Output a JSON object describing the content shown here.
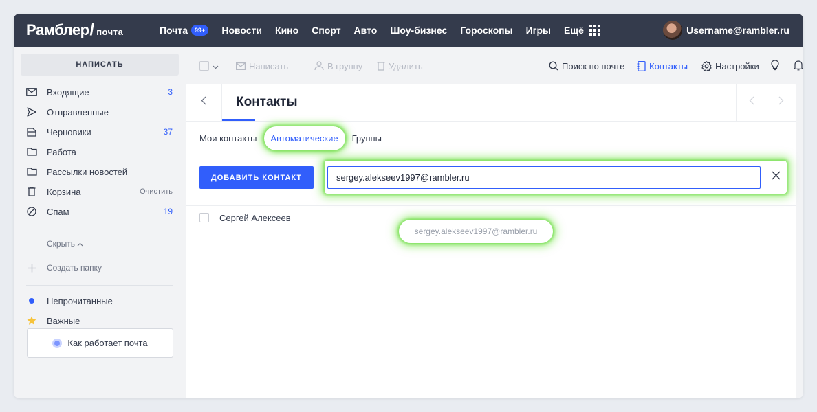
{
  "header": {
    "logo_main": "Рамблер",
    "logo_slash": "/",
    "logo_sub": "почта",
    "nav": [
      {
        "label": "Почта",
        "badge": "99+"
      },
      {
        "label": "Новости"
      },
      {
        "label": "Кино"
      },
      {
        "label": "Спорт"
      },
      {
        "label": "Авто"
      },
      {
        "label": "Шоу-бизнес"
      },
      {
        "label": "Гороскопы"
      },
      {
        "label": "Игры"
      },
      {
        "label": "Ещё"
      }
    ],
    "user": "Username@rambler.ru"
  },
  "sidebar": {
    "compose_label": "НАПИСАТЬ",
    "folders": [
      {
        "label": "Входящие",
        "count": "3",
        "icon": "inbox-icon"
      },
      {
        "label": "Отправленные",
        "count": "",
        "icon": "sent-icon"
      },
      {
        "label": "Черновики",
        "count": "37",
        "icon": "drafts-icon"
      },
      {
        "label": "Работа",
        "count": "",
        "icon": "folder-icon"
      },
      {
        "label": "Рассылки новостей",
        "count": "",
        "icon": "folder-icon"
      },
      {
        "label": "Корзина",
        "action": "Очистить",
        "icon": "trash-icon"
      },
      {
        "label": "Спам",
        "count": "19",
        "icon": "spam-icon"
      }
    ],
    "hide_label": "Скрыть",
    "create_folder": "Создать папку",
    "unread": "Непрочитанные",
    "important": "Важные",
    "help": "Как работает почта"
  },
  "toolbar": {
    "compose": "Написать",
    "to_group": "В группу",
    "delete": "Удалить",
    "search": "Поиск по почте",
    "contacts": "Контакты",
    "settings": "Настройки"
  },
  "contacts": {
    "title": "Контакты",
    "tabs": [
      "Мои контакты",
      "Автоматические",
      "Группы"
    ],
    "active_tab": "Автоматические",
    "add_button": "ДОБАВИТЬ КОНТАКТ",
    "search_value": "sergey.alekseev1997@rambler.ru",
    "rows": [
      {
        "name": "Сергей Алексеев",
        "email": "sergey.alekseev1997@rambler.ru"
      }
    ]
  },
  "colors": {
    "header_bg": "#343b4c",
    "accent": "#315efb",
    "highlight": "#7ee05a"
  }
}
